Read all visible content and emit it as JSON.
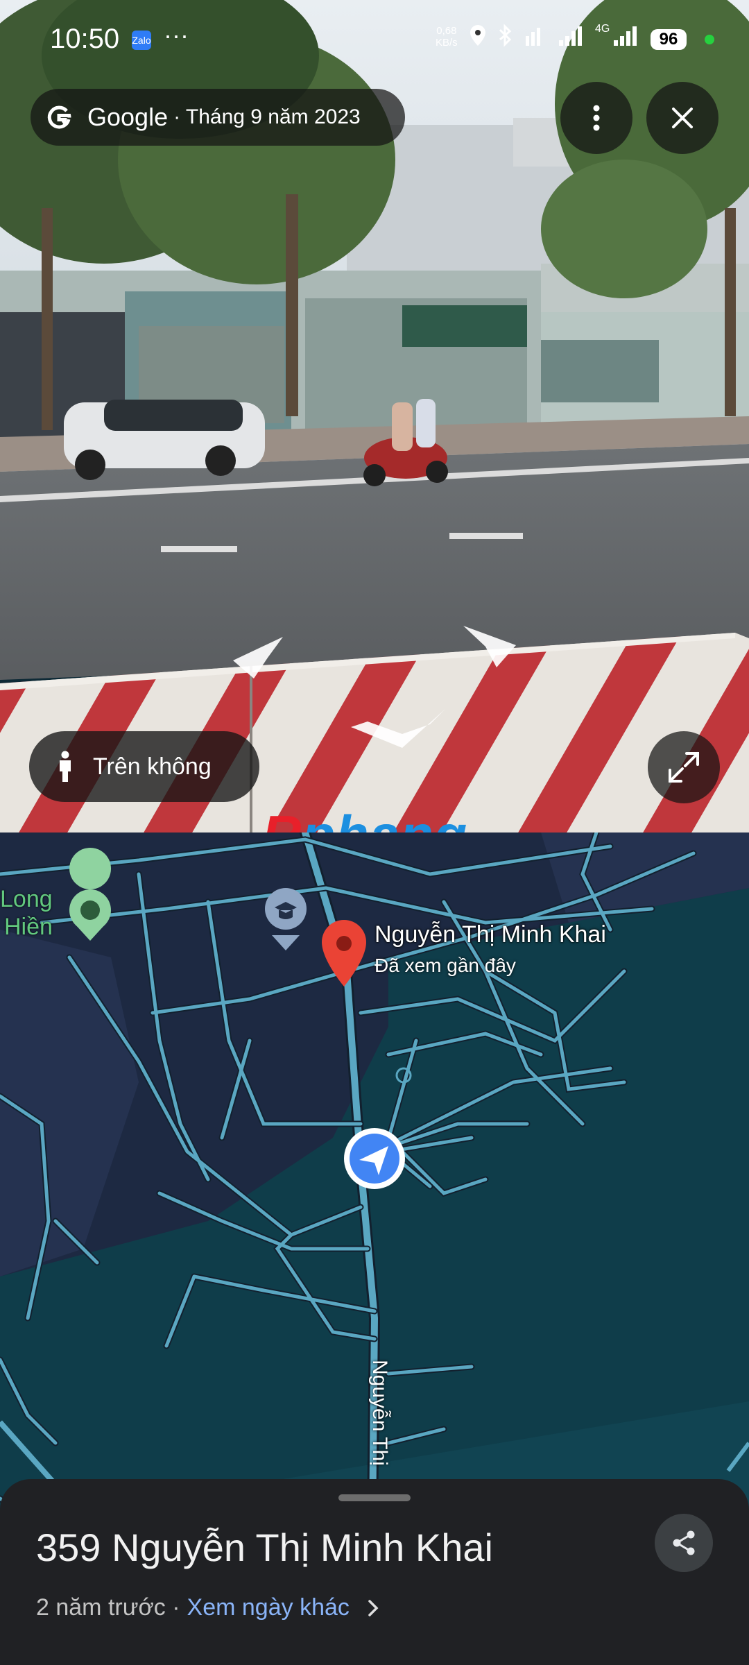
{
  "status_bar": {
    "time": "10:50",
    "notif_app": "Zalo",
    "more": "···",
    "net_speed_value": "0,68",
    "net_speed_unit": "KB/s",
    "network_type": "4G",
    "battery": "96"
  },
  "street_view": {
    "brand": "Google",
    "date": "· Tháng 9 năm 2023",
    "aerial_label": "Trên không",
    "watermark_r": "R",
    "watermark_rest": "phang"
  },
  "map": {
    "place_name": "Nguyễn Thị Minh Khai",
    "place_sub": "Đã xem gần đây",
    "poi_label_line1": "Long",
    "poi_label_line2": "Hiền",
    "street_label": "Nguyễn Thị"
  },
  "sheet": {
    "address": "359 Nguyễn Thị Minh Khai",
    "time_ago": "2 năm trước ·",
    "other_dates_link": "Xem ngày khác"
  },
  "colors": {
    "road": "#5aa7c2",
    "map_land": "#1d2942",
    "map_water": "#0f3d4a",
    "pin_red": "#ea4335",
    "location_blue": "#4285f4",
    "sheet_bg": "#202124",
    "link": "#8ab4f8"
  },
  "icons": [
    "google-g-icon",
    "more-vert-icon",
    "close-icon",
    "person-icon",
    "expand-icon",
    "share-icon",
    "chevron-right-icon",
    "location-pin-icon",
    "school-icon",
    "park-icon",
    "navigation-arrow-icon"
  ]
}
